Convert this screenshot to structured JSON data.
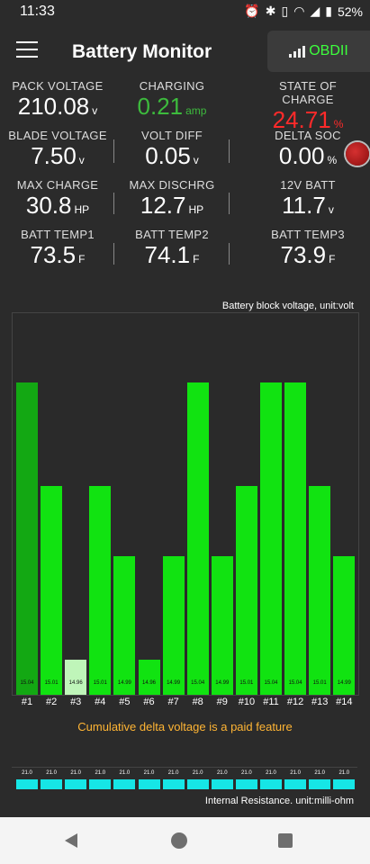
{
  "status": {
    "time": "11:33",
    "battery": "52%"
  },
  "app": {
    "title": "Battery Monitor",
    "obd_label": "OBDII"
  },
  "metrics": [
    [
      {
        "label": "PACK VOLTAGE",
        "value": "210.08",
        "unit": "v",
        "color": "#ffffff"
      },
      {
        "label": "CHARGING",
        "value": "0.21",
        "unit": "amp",
        "color": "#3dbb3d"
      },
      {
        "label": "STATE OF CHARGE",
        "value": "24.71",
        "unit": "%",
        "color": "#ff2a2a"
      }
    ],
    [
      {
        "label": "BLADE VOLTAGE",
        "value": "7.50",
        "unit": "v",
        "color": "#ffffff"
      },
      {
        "label": "VOLT DIFF",
        "value": "0.05",
        "unit": "v",
        "color": "#ffffff"
      },
      {
        "label": "DELTA SOC",
        "value": "0.00",
        "unit": "%",
        "color": "#ffffff"
      }
    ],
    [
      {
        "label": "MAX CHARGE",
        "value": "30.8",
        "unit": "HP",
        "color": "#ffffff"
      },
      {
        "label": "MAX DISCHRG",
        "value": "12.7",
        "unit": "HP",
        "color": "#ffffff"
      },
      {
        "label": "12V BATT",
        "value": "11.7",
        "unit": "v",
        "color": "#ffffff"
      }
    ],
    [
      {
        "label": "BATT TEMP1",
        "value": "73.5",
        "unit": "F",
        "color": "#ffffff"
      },
      {
        "label": "BATT TEMP2",
        "value": "74.1",
        "unit": "F",
        "color": "#ffffff"
      },
      {
        "label": "BATT TEMP3",
        "value": "73.9",
        "unit": "F",
        "color": "#ffffff"
      }
    ]
  ],
  "chart_data": {
    "type": "bar",
    "title": "Battery block voltage, unit:volt",
    "categories": [
      "#1",
      "#2",
      "#3",
      "#4",
      "#5",
      "#6",
      "#7",
      "#8",
      "#9",
      "#10",
      "#11",
      "#12",
      "#13",
      "#14"
    ],
    "values": [
      15.04,
      15.01,
      14.96,
      15.01,
      14.99,
      14.96,
      14.99,
      15.04,
      14.99,
      15.01,
      15.04,
      15.04,
      15.01,
      14.99
    ],
    "labels": [
      "15.04",
      "15.01",
      "14.96",
      "15.01",
      "14.99",
      "14.96",
      "14.99",
      "15.04",
      "14.99",
      "15.01",
      "15.04",
      "15.04",
      "15.01",
      "14.99"
    ],
    "ylim": [
      14.95,
      15.05
    ]
  },
  "paid_note": "Cumulative delta voltage is a paid feature",
  "resistance": {
    "title": "Internal Resistance. unit:milli-ohm",
    "values": [
      "21.0",
      "21.0",
      "21.0",
      "21.0",
      "21.0",
      "21.0",
      "21.0",
      "21.0",
      "21.0",
      "21.0",
      "21.0",
      "21.0",
      "21.0",
      "21.0"
    ]
  }
}
